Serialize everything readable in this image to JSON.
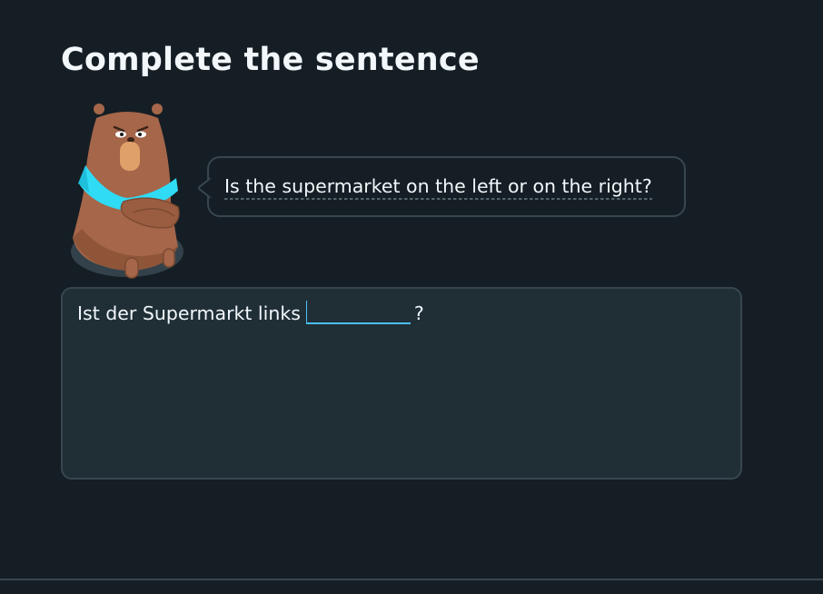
{
  "header": {
    "title": "Complete the sentence"
  },
  "character": {
    "icon": "bear-character-icon",
    "colors": {
      "fur": "#a5664a",
      "scarf": "#2fdbf5",
      "snout": "#e0a06a"
    }
  },
  "prompt": {
    "text": "Is the supermarket on the left or on the right?"
  },
  "exercise": {
    "before_text": "Ist der Supermarkt links",
    "input_value": "",
    "after_text": "?"
  },
  "colors": {
    "background": "#151e24",
    "panel": "#202f36",
    "border": "#37464f",
    "accent": "#49c0f8"
  }
}
